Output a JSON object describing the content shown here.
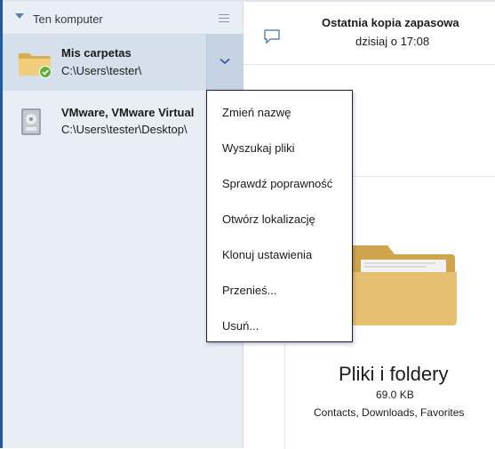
{
  "sidebar": {
    "title": "Ten komputer",
    "items": [
      {
        "name": "Mis carpetas",
        "path": "C:\\Users\\tester\\"
      },
      {
        "name": "VMware, VMware Virtual",
        "path": "C:\\Users\\tester\\Desktop\\"
      }
    ]
  },
  "header": {
    "last_backup_label": "Ostatnia kopia zapasowa",
    "last_backup_time": "dzisiaj o 17:08"
  },
  "context_menu": {
    "items": [
      "Zmień nazwę",
      "Wyszukaj pliki",
      "Sprawdź poprawność",
      "Otwórz lokalizację",
      "Klonuj ustawienia",
      "Przenieś...",
      "Usuń..."
    ]
  },
  "backup_card": {
    "title": "Pliki i foldery",
    "size": "69.0 KB",
    "contents": "Contacts, Downloads, Favorites"
  },
  "colors": {
    "accent": "#1e5aa8",
    "sidebar_bg": "#e9eef4",
    "selected_bg": "#d6e0ec",
    "folder": "#e4c070",
    "status_ok": "#5fb036"
  }
}
